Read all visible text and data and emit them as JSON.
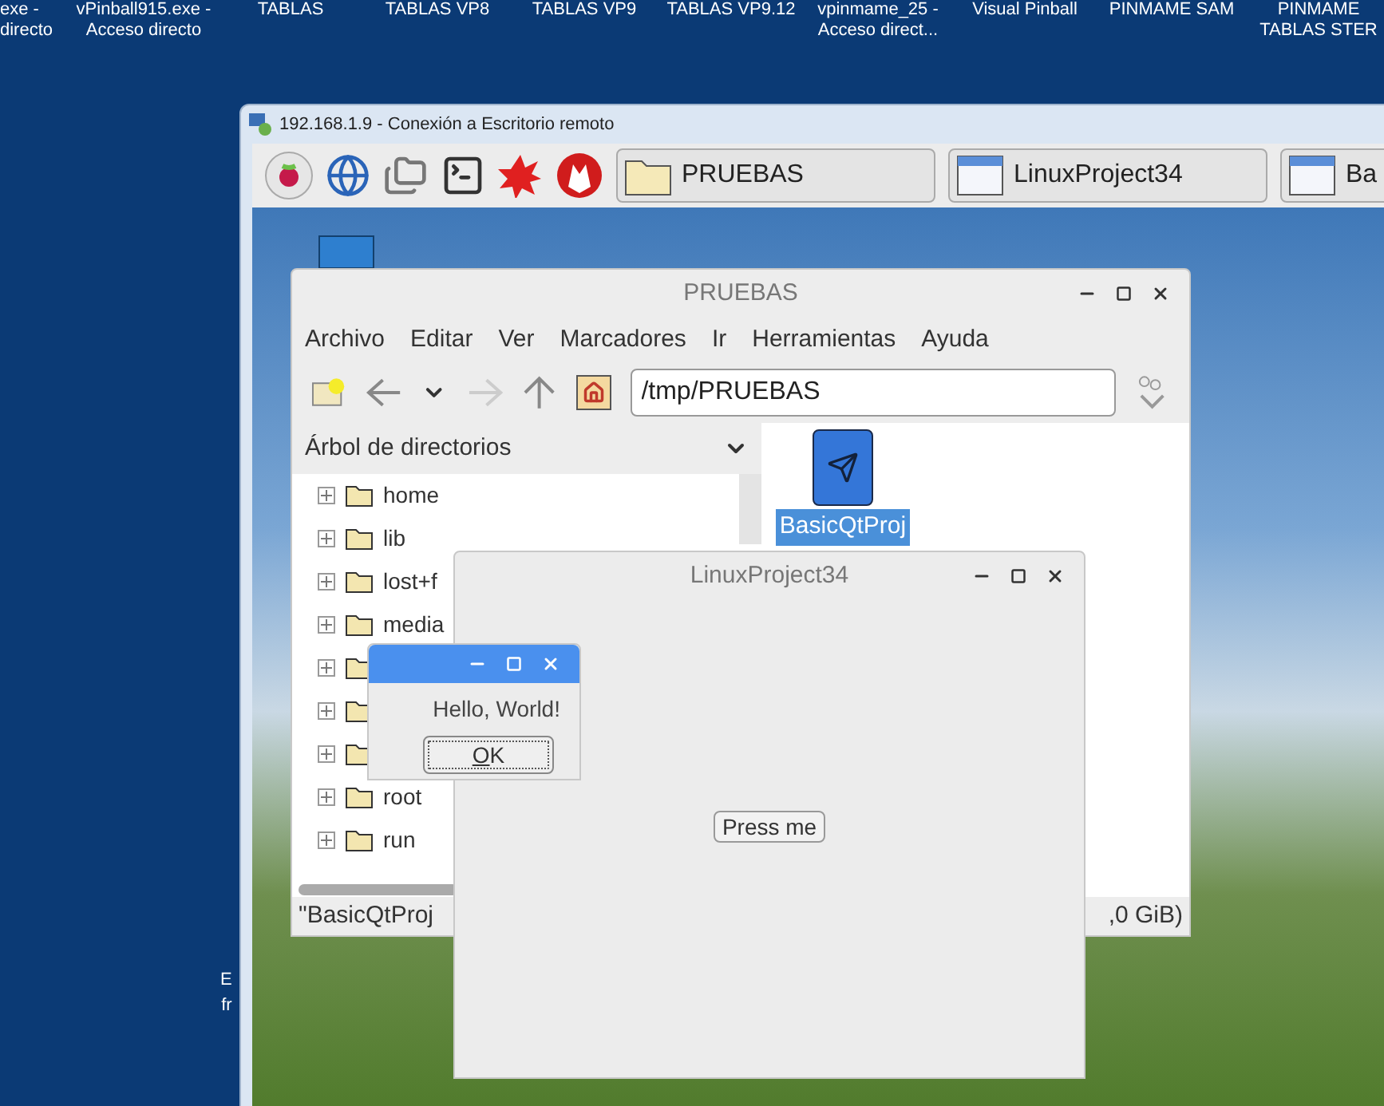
{
  "desktop_icons": [
    {
      "lines": [
        "exe -",
        "directo"
      ]
    },
    {
      "lines": [
        "vPinball915.exe -",
        "Acceso directo"
      ]
    },
    {
      "lines": [
        "TABLAS"
      ]
    },
    {
      "lines": [
        "TABLAS VP8"
      ]
    },
    {
      "lines": [
        "TABLAS VP9"
      ]
    },
    {
      "lines": [
        "TABLAS VP9.12"
      ]
    },
    {
      "lines": [
        "vpinmame_25 -",
        "Acceso direct..."
      ]
    },
    {
      "lines": [
        "Visual Pinball"
      ]
    },
    {
      "lines": [
        "PINMAME SAM"
      ]
    },
    {
      "lines": [
        "PINMAME",
        "TABLAS STER"
      ]
    }
  ],
  "desktop_partial_label": [
    "E",
    "fr"
  ],
  "remote_window": {
    "title": "192.168.1.9 - Conexión a Escritorio remoto"
  },
  "taskbar": {
    "tasks": [
      {
        "label": "PRUEBAS",
        "kind": "folder"
      },
      {
        "label": "LinuxProject34",
        "kind": "window"
      },
      {
        "label": "Ba",
        "kind": "window"
      }
    ]
  },
  "file_manager": {
    "title": "PRUEBAS",
    "menu": [
      "Archivo",
      "Editar",
      "Ver",
      "Marcadores",
      "Ir",
      "Herramientas",
      "Ayuda"
    ],
    "back": {
      "disabled": false
    },
    "forward": {
      "disabled": true
    },
    "path": "/tmp/PRUEBAS",
    "side_panel": {
      "title": "Árbol de directorios",
      "items": [
        {
          "label": "home",
          "expanded": false
        },
        {
          "label": "lib",
          "expanded": false
        },
        {
          "label": "lost+f",
          "expanded": false
        },
        {
          "label": "media",
          "expanded": false
        },
        {
          "expanded": false
        },
        {
          "expanded": false
        },
        {
          "expanded": false
        },
        {
          "label": "root",
          "expanded": false
        },
        {
          "label": "run",
          "expanded": false
        }
      ]
    },
    "files": [
      {
        "label": "BasicQtProj",
        "selected": true
      }
    ],
    "status_bar": {
      "left": "\"BasicQtProj",
      "right": ",0 GiB)"
    }
  },
  "app_window": {
    "title": "LinuxProject34",
    "button": "Press me"
  },
  "dialog": {
    "message": "Hello, World!",
    "button": "OK"
  }
}
